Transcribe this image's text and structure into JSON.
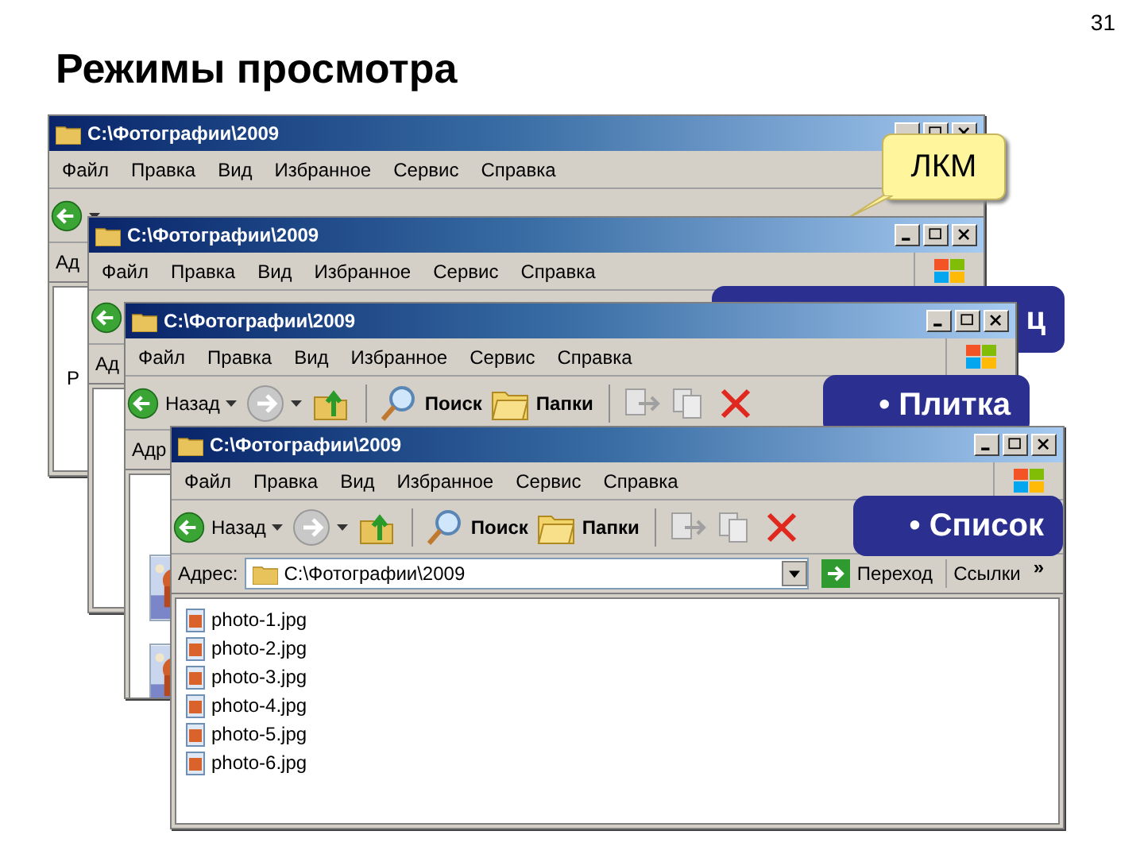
{
  "slide": {
    "title": "Режимы просмотра",
    "page_number": "31"
  },
  "windows": [
    {
      "title": "C:\\Фотографии\\2009",
      "menu": [
        "Файл",
        "Правка",
        "Вид",
        "Избранное",
        "Сервис",
        "Справка"
      ],
      "toolbar": [
        {
          "kind": "back"
        }
      ],
      "address": {
        "label": "Ад"
      },
      "content_text": "Р",
      "callout": {
        "kind": "note",
        "text": "ЛКМ"
      }
    },
    {
      "title": "C:\\Фотографии\\2009",
      "menu": [
        "Файл",
        "Правка",
        "Вид",
        "Избранное",
        "Сервис",
        "Справка"
      ],
      "toolbar": [
        {
          "kind": "back"
        }
      ],
      "address": {
        "label": "Ад"
      },
      "callout": {
        "kind": "label",
        "text": "ц"
      }
    },
    {
      "title": "C:\\Фотографии\\2009",
      "menu": [
        "Файл",
        "Правка",
        "Вид",
        "Избранное",
        "Сервис",
        "Справка"
      ],
      "toolbar": [
        {
          "kind": "back",
          "label": "Назад"
        },
        {
          "kind": "forward"
        },
        {
          "kind": "up"
        },
        {
          "kind": "search",
          "label": "Поиск"
        },
        {
          "kind": "folders",
          "label": "Папки"
        },
        {
          "kind": "move"
        },
        {
          "kind": "copy"
        },
        {
          "kind": "delete"
        }
      ],
      "address": {
        "label": "Адр"
      },
      "callout": {
        "kind": "label",
        "text": "• Плитка"
      }
    },
    {
      "title": "C:\\Фотографии\\2009",
      "menu": [
        "Файл",
        "Правка",
        "Вид",
        "Избранное",
        "Сервис",
        "Справка"
      ],
      "toolbar": [
        {
          "kind": "back",
          "label": "Назад"
        },
        {
          "kind": "forward"
        },
        {
          "kind": "up"
        },
        {
          "kind": "search",
          "label": "Поиск"
        },
        {
          "kind": "folders",
          "label": "Папки"
        },
        {
          "kind": "move"
        },
        {
          "kind": "copy"
        },
        {
          "kind": "delete"
        }
      ],
      "address": {
        "label": "Адрес:",
        "value": "C:\\Фотографии\\2009",
        "go_label": "Переход",
        "links_label": "Ссылки",
        "chevron": "»"
      },
      "files": [
        "photo-1.jpg",
        "photo-2.jpg",
        "photo-3.jpg",
        "photo-4.jpg",
        "photo-5.jpg",
        "photo-6.jpg"
      ],
      "callout": {
        "kind": "label",
        "text": "• Список"
      }
    }
  ]
}
